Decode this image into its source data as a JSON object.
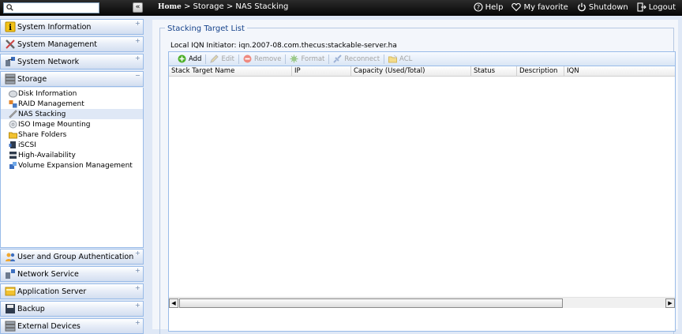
{
  "topbar": {
    "search_value": "",
    "collapse_glyph": "«",
    "breadcrumb": {
      "home": "Home",
      "sep1": " > ",
      "section": "Storage",
      "sep2": " > ",
      "page": "NAS Stacking"
    },
    "links": [
      {
        "label": "Help",
        "icon": "help-icon"
      },
      {
        "label": "My favorite",
        "icon": "heart-icon"
      },
      {
        "label": "Shutdown",
        "icon": "power-icon"
      },
      {
        "label": "Logout",
        "icon": "logout-icon"
      }
    ]
  },
  "sidebar": {
    "sections": [
      {
        "label": "System Information",
        "icon": "info-icon"
      },
      {
        "label": "System Management",
        "icon": "tools-icon"
      },
      {
        "label": "System Network",
        "icon": "network-icon"
      },
      {
        "label": "Storage",
        "icon": "storage-icon"
      },
      {
        "label": "User and Group Authentication",
        "icon": "users-icon"
      },
      {
        "label": "Network Service",
        "icon": "network-service-icon"
      },
      {
        "label": "Application Server",
        "icon": "app-server-icon"
      },
      {
        "label": "Backup",
        "icon": "backup-icon"
      },
      {
        "label": "External Devices",
        "icon": "external-devices-icon"
      }
    ],
    "storage_items": [
      {
        "label": "Disk Information",
        "icon": "disk-icon"
      },
      {
        "label": "RAID Management",
        "icon": "raid-icon"
      },
      {
        "label": "NAS Stacking",
        "icon": "stacking-icon",
        "selected": true
      },
      {
        "label": "ISO Image Mounting",
        "icon": "iso-icon"
      },
      {
        "label": "Share Folders",
        "icon": "folder-icon"
      },
      {
        "label": "iSCSI",
        "icon": "iscsi-icon"
      },
      {
        "label": "High-Availability",
        "icon": "ha-icon"
      },
      {
        "label": "Volume Expansion Management",
        "icon": "volume-icon"
      }
    ]
  },
  "main": {
    "legend": "Stacking Target List",
    "iqn_label": "Local IQN Initiator: iqn.2007-08.com.thecus:stackable-server.ha",
    "toolbar": {
      "add": "Add",
      "edit": "Edit",
      "remove": "Remove",
      "format": "Format",
      "reconnect": "Reconnect",
      "acl": "ACL"
    },
    "columns": [
      "Stack Target Name",
      "IP",
      "Capacity (Used/Total)",
      "Status",
      "Description",
      "IQN"
    ],
    "rows": []
  },
  "colors": {
    "topbar_bg": "#050505",
    "panel_border": "#99bbe8",
    "accent_text": "#15428b",
    "add_green": "#4caf27",
    "remove_red": "#e04a3a"
  }
}
